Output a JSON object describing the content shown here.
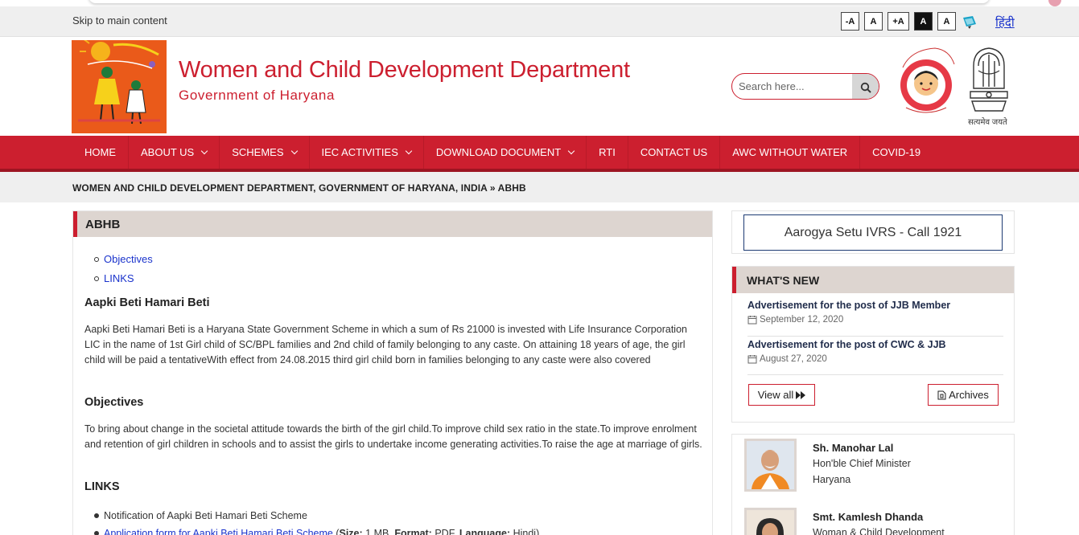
{
  "topbar": {
    "skip_link": "Skip to main content",
    "a11y": {
      "decrease": "-A",
      "normal": "A",
      "increase": "+A",
      "high_contrast": "A",
      "normal_contrast": "A"
    },
    "language": "हिंदी"
  },
  "header": {
    "title": "Women and Child Development Department",
    "subtitle": "Government of Haryana",
    "search_placeholder": "Search here...",
    "emblem_motto": "सत्यमेव जयते"
  },
  "nav": {
    "items": [
      {
        "label": "HOME",
        "dropdown": false
      },
      {
        "label": "ABOUT US",
        "dropdown": true
      },
      {
        "label": "SCHEMES",
        "dropdown": true
      },
      {
        "label": "IEC ACTIVITIES",
        "dropdown": true
      },
      {
        "label": "DOWNLOAD DOCUMENT",
        "dropdown": true
      },
      {
        "label": "RTI",
        "dropdown": false
      },
      {
        "label": "CONTACT US",
        "dropdown": false
      },
      {
        "label": "AWC WITHOUT WATER",
        "dropdown": false
      },
      {
        "label": "COVID-19",
        "dropdown": false
      }
    ]
  },
  "breadcrumb": "WOMEN AND CHILD DEVELOPMENT DEPARTMENT, GOVERNMENT OF HARYANA, INDIA » ABHB",
  "main": {
    "heading": "ABHB",
    "toc": [
      "Objectives",
      "LINKS"
    ],
    "section1_title": "Aapki Beti Hamari Beti",
    "section1_body": "Aapki Beti Hamari Beti is a Haryana State Government Scheme in which a sum of Rs 21000 is invested with Life Insurance Corporation LIC in the name of 1st Girl child of SC/BPL families and 2nd child of family belonging to any caste. On attaining 18 years of age, the girl child will be paid a tentativeWith effect from 24.08.2015 third girl child born in families belonging to any caste were also covered",
    "section2_title": "Objectives",
    "section2_body": "To bring about change in the societal attitude towards the birth of the girl child.To improve child sex ratio in the state.To improve enrolment and retention of girl children in schools and to assist the girls to undertake income generating activities.To raise the age at marriage of girls.",
    "section3_title": "LINKS",
    "links": {
      "notification": "Notification of Aapki Beti Hamari Beti Scheme",
      "application_link": "Application form for Aapki Beti Hamari Beti Scheme",
      "size_label": "Size:",
      "size_value": "1 MB,",
      "format_label": "Format:",
      "format_value": "PDF,",
      "language_label": "Language:",
      "language_value": "Hindi"
    }
  },
  "sidebar": {
    "aarogya": "Aarogya Setu IVRS - Call 1921",
    "whats_new": {
      "heading": "WHAT'S NEW",
      "items": [
        {
          "title": "Advertisement for the post of JJB Member",
          "date": "September 12, 2020"
        },
        {
          "title": "Advertisement for the post of CWC & JJB",
          "date": "August 27, 2020"
        }
      ],
      "view_all": "View all",
      "archives": "Archives"
    },
    "people": [
      {
        "name": "Sh. Manohar Lal",
        "role1": "Hon'ble Chief Minister",
        "role2": "Haryana"
      },
      {
        "name": "Smt. Kamlesh Dhanda",
        "role1": "Woman & Child Development"
      }
    ]
  },
  "colors": {
    "brand_red": "#cc1f2f",
    "nav_dark": "#9d1522",
    "panel_head": "#ddd5d0",
    "link_blue": "#1a33cc"
  }
}
